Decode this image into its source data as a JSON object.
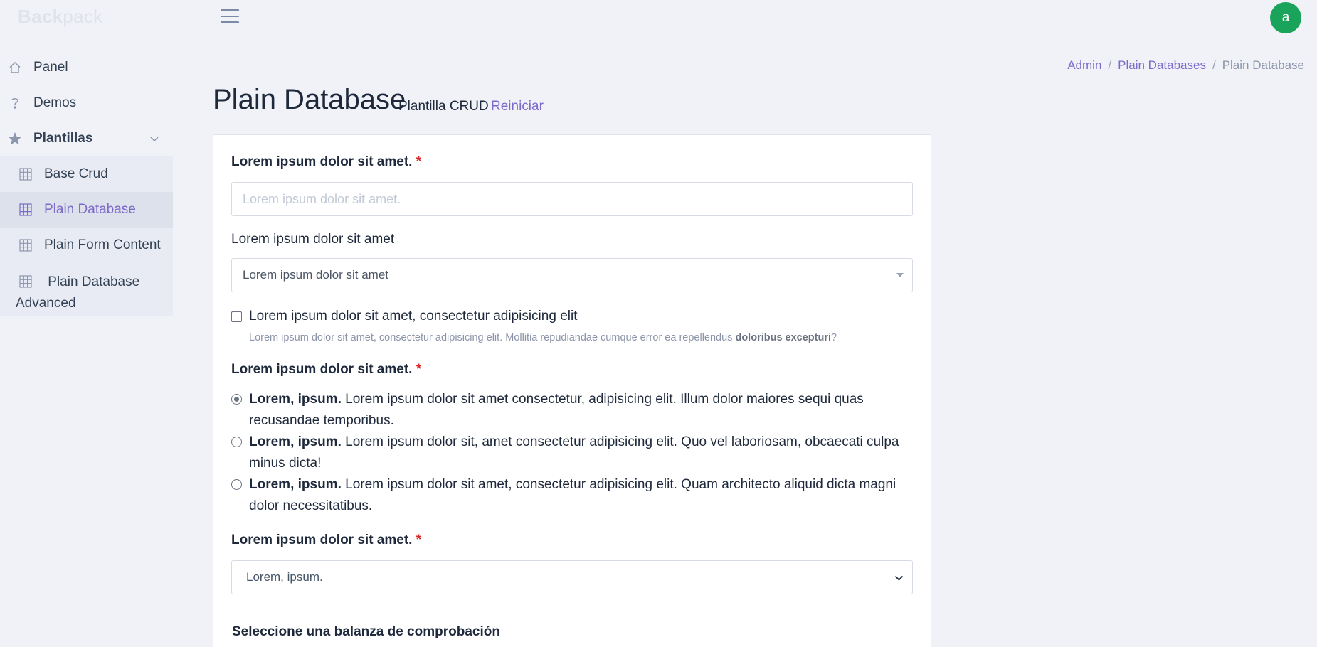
{
  "brand": {
    "bold": "Back",
    "light": "pack"
  },
  "user": {
    "avatar_letter": "a"
  },
  "sidebar": {
    "items": [
      {
        "label": "Panel",
        "icon": "home-icon"
      },
      {
        "label": "Demos",
        "icon": "question-icon"
      },
      {
        "label": "Plantillas",
        "icon": "star-icon"
      }
    ],
    "sub_items": [
      {
        "label": "Base Crud",
        "icon": "table-icon"
      },
      {
        "label": "Plain Database",
        "icon": "table-icon",
        "active": true
      },
      {
        "label": "Plain Form Content",
        "icon": "table-icon"
      },
      {
        "label": "Plain Database Advanced",
        "icon": "table-icon"
      }
    ]
  },
  "breadcrumb": {
    "items": [
      "Admin",
      "Plain Databases",
      "Plain Database"
    ],
    "separator": "/"
  },
  "header": {
    "title": "Plain Database",
    "subtitle": "Plantilla CRUD",
    "reset_label": "Reiniciar"
  },
  "form": {
    "field1": {
      "label": "Lorem ipsum dolor sit amet.",
      "required_mark": "*",
      "placeholder": "Lorem ipsum dolor sit amet."
    },
    "field2": {
      "label": "Lorem ipsum dolor sit amet",
      "selected": "Lorem ipsum dolor sit amet"
    },
    "checkbox": {
      "label": "Lorem ipsum dolor sit amet, consectetur adipisicing elit",
      "hint_text": "Lorem ipsum dolor sit amet, consectetur adipisicing elit. Mollitia repudiandae cumque error ea repellendus ",
      "hint_bold": "doloribus excepturi",
      "hint_end": "?"
    },
    "field3": {
      "label": "Lorem ipsum dolor sit amet.",
      "required_mark": "*",
      "options": [
        {
          "bold": "Lorem, ipsum.",
          "text": " Lorem ipsum dolor sit amet consectetur, adipisicing elit. Illum dolor maiores sequi quas recusandae temporibus.",
          "checked": true
        },
        {
          "bold": "Lorem, ipsum.",
          "text": " Lorem ipsum dolor sit, amet consectetur adipisicing elit. Quo vel laboriosam, obcaecati culpa minus dicta!",
          "checked": false
        },
        {
          "bold": "Lorem, ipsum.",
          "text": " Lorem ipsum dolor sit amet, consectetur adipisicing elit. Quam architecto aliquid dicta magni dolor necessitatibus.",
          "checked": false
        }
      ]
    },
    "field4": {
      "label": "Lorem ipsum dolor sit amet.",
      "required_mark": "*",
      "selected": "Lorem, ipsum."
    },
    "field5": {
      "label": "Seleccione una balanza de comprobación"
    }
  },
  "colors": {
    "accent": "#7c69c9",
    "avatar_bg": "#1aa35a",
    "required": "#dc2626",
    "background": "#f0f2f8"
  }
}
